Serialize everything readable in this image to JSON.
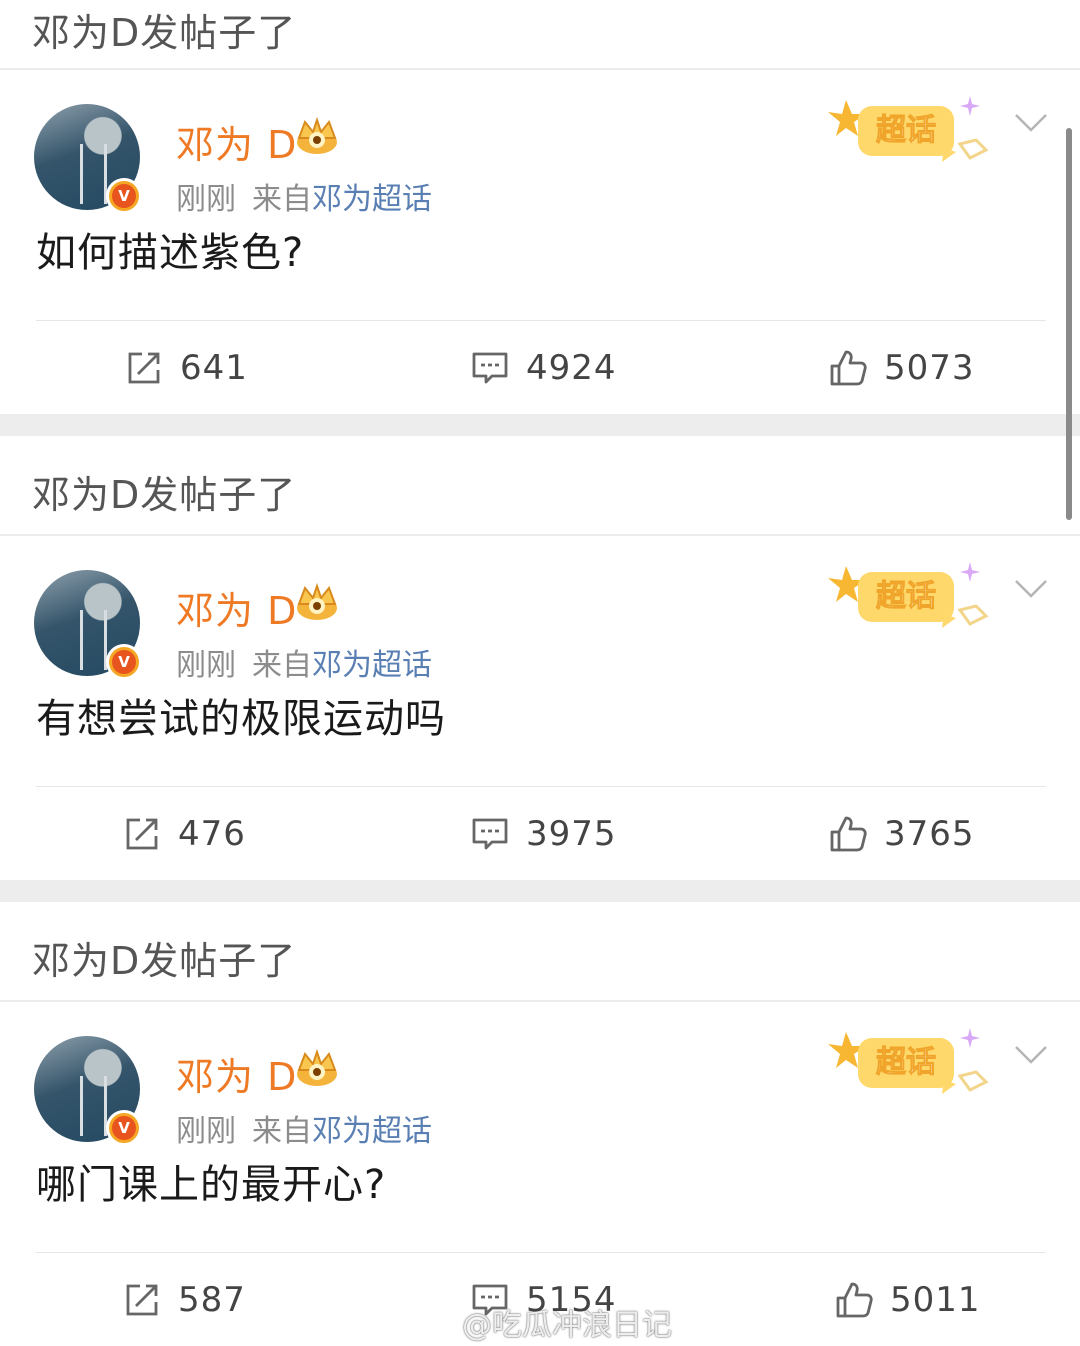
{
  "header_title": "邓为D发帖子了",
  "posts": [
    {
      "username": "邓为 D",
      "time": "刚刚",
      "source_prefix": "来自",
      "source": "邓为超话",
      "badge": "超话",
      "content": "如何描述紫色?",
      "reposts": "641",
      "comments": "4924",
      "likes": "5073"
    },
    {
      "username": "邓为 D",
      "time": "刚刚",
      "source_prefix": "来自",
      "source": "邓为超话",
      "badge": "超话",
      "content": "有想尝试的极限运动吗",
      "reposts": "476",
      "comments": "3975",
      "likes": "3765"
    },
    {
      "username": "邓为 D",
      "time": "刚刚",
      "source_prefix": "来自",
      "source": "邓为超话",
      "badge": "超话",
      "content": "哪门课上的最开心?",
      "reposts": "587",
      "comments": "5154",
      "likes": "5011"
    }
  ],
  "watermark": "@吃瓜冲浪日记",
  "colors": {
    "username": "#ef7a25",
    "source_link": "#5a7fb3",
    "meta_gray": "#8c8c8c",
    "badge_bg": "#ffd86b"
  },
  "icons": {
    "repost": "repost-icon",
    "comment": "comment-icon",
    "like": "thumbs-up-icon",
    "more": "chevron-down-icon",
    "verified": "verified-v-icon",
    "crown": "crown-icon",
    "watermark_logo": "weibo-logo-icon"
  }
}
